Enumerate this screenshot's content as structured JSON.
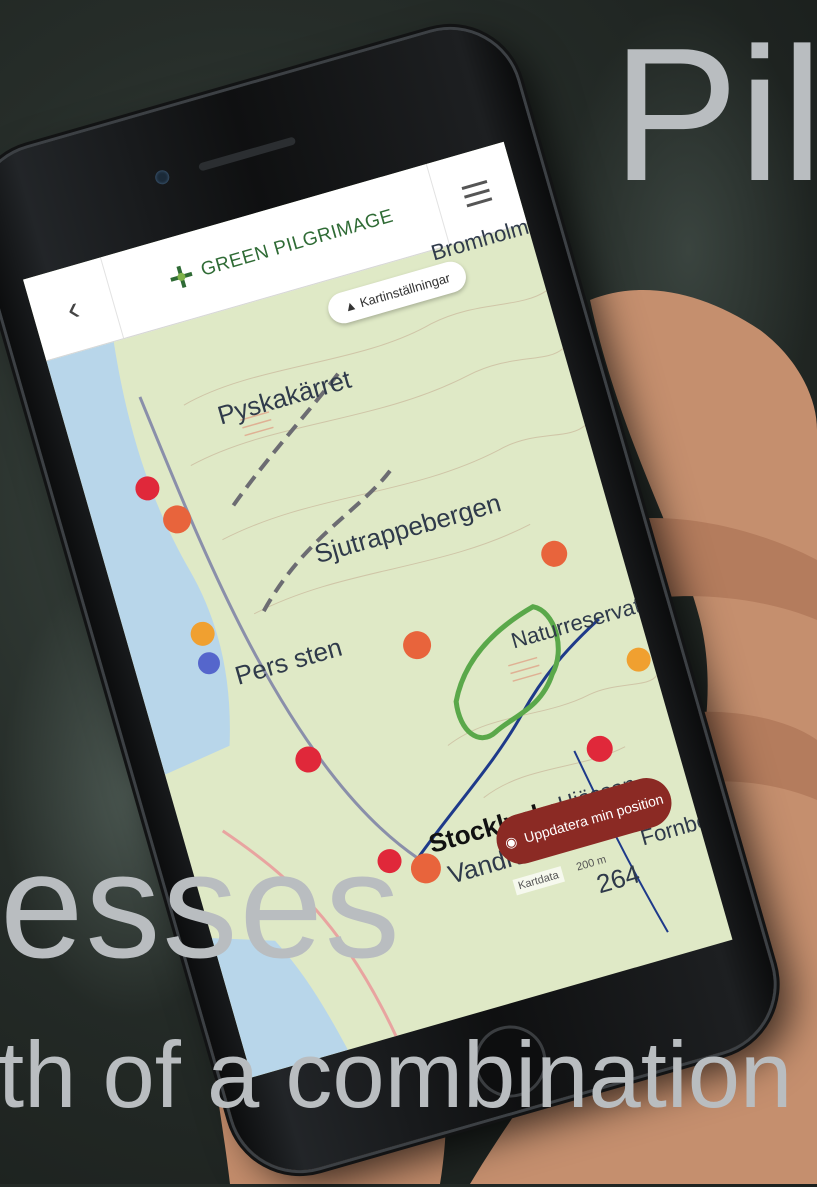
{
  "overlay": {
    "title_fragment": "Pil",
    "heading_fragment": "esses",
    "subtitle_fragment": "th of a combination"
  },
  "app": {
    "brand": "GREEN PILGRIMAGE",
    "settings_button": "Kartinställningar",
    "update_button": "Uppdatera min position",
    "kartdata": "Kartdata",
    "scale": "200 m"
  },
  "map_labels": {
    "pyskakarret": "Pyskakärret",
    "sjutrappebergen": "Sjutrappebergen",
    "pers_sten": "Pers sten",
    "naturreservat": "Naturreservat",
    "stocklycke": "Stocklycke",
    "vandrarhem": "Vandrarhem",
    "hjassan": "Hjässan",
    "fornborg": "Fornborg",
    "elevation": "264",
    "bromholm": "Bromholm"
  },
  "colors": {
    "map_bg": "#dfe9c6",
    "brand_green": "#2f6b35",
    "update_button": "#8b2a24",
    "marker_orange": "#e8643c",
    "marker_red": "#e0283a",
    "trail_blue": "#1e3a8a",
    "water": "#b8d6ea"
  }
}
